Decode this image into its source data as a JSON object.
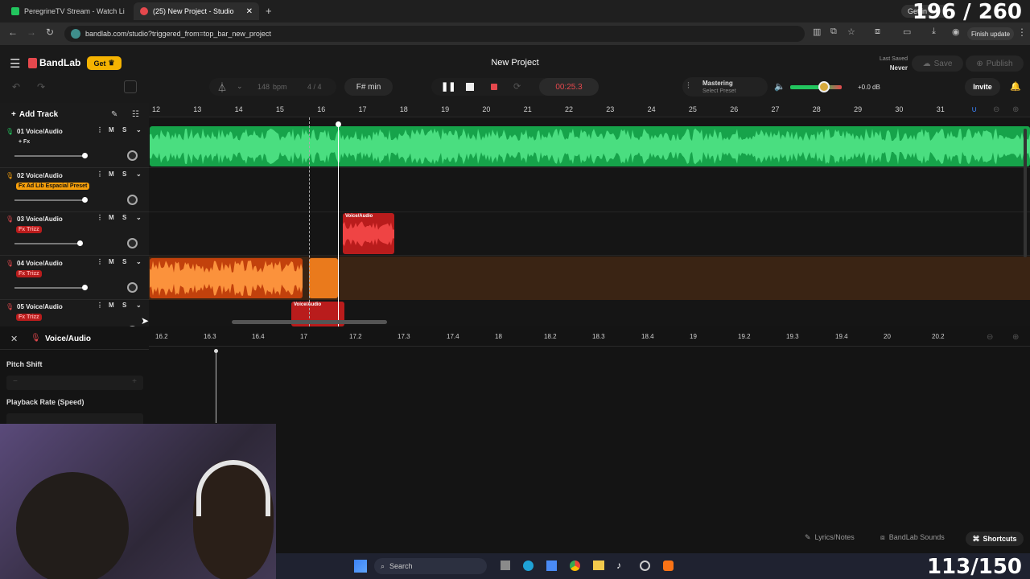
{
  "counters": {
    "top": "196 / 260",
    "bottom": "113/150"
  },
  "browser": {
    "tabs": [
      {
        "label": "PeregrineTV Stream - Watch Li",
        "fav_color": "#22c55e",
        "active": false
      },
      {
        "label": "(25) New Project - Studio",
        "fav_color": "#e5484d",
        "active": true
      }
    ],
    "new_tab": "+",
    "url": "bandlab.com/studio?triggered_from=top_bar_new_project",
    "get_label": "Get in",
    "finish_update": "Finish update"
  },
  "app": {
    "logo": "BandLab",
    "get_button": "Get",
    "project_title": "New Project",
    "last_saved_label": "Last Saved",
    "last_saved_value": "Never",
    "save": "Save",
    "publish": "Publish",
    "bpm_value": "148",
    "bpm_unit": "bpm",
    "time_sig": "4 / 4",
    "key": "F# min",
    "time": "00:25.3",
    "mastering": "Mastering",
    "select_preset": "Select Preset",
    "volume_db": "+0.0 dB",
    "invite": "Invite",
    "add_track": "Add Track"
  },
  "ruler": [
    "12",
    "13",
    "14",
    "15",
    "16",
    "17",
    "18",
    "19",
    "20",
    "21",
    "22",
    "23",
    "24",
    "25",
    "26",
    "27",
    "28",
    "29",
    "30",
    "31"
  ],
  "tracks": [
    {
      "name": "01  Voice/Audio",
      "fx": "+ Fx",
      "fx_style": "plain",
      "color": "#22c55e",
      "volume": 0.7
    },
    {
      "name": "02  Voice/Audio",
      "fx": "Fx Ad Lib Espacial Preset",
      "fx_style": "orange",
      "color": "#f59e0b",
      "volume": 0.7
    },
    {
      "name": "03  Voice/Audio",
      "fx": "Fx Trizz",
      "fx_style": "red",
      "color": "#e5484d",
      "volume": 0.65
    },
    {
      "name": "04  Voice/Audio",
      "fx": "Fx Trizz",
      "fx_style": "red",
      "color": "#e5484d",
      "volume": 0.7
    },
    {
      "name": "05  Voice/Audio",
      "fx": "Fx Trizz",
      "fx_style": "red",
      "color": "#e5484d",
      "volume": 0.7
    }
  ],
  "ms": {
    "m": "M",
    "s": "S"
  },
  "clips": {
    "label": "Voice/Audio"
  },
  "editor": {
    "title": "Voice/Audio",
    "ruler": [
      "16.2",
      "16.3",
      "16.4",
      "17",
      "17.2",
      "17.3",
      "17.4",
      "18",
      "18.2",
      "18.3",
      "18.4",
      "19",
      "19.2",
      "19.3",
      "19.4",
      "20",
      "20.2"
    ],
    "pitch_shift": "Pitch Shift",
    "playback_rate": "Playback Rate (Speed)"
  },
  "bottom": {
    "lyrics": "Lyrics/Notes",
    "sounds": "BandLab Sounds",
    "shortcuts": "Shortcuts"
  },
  "taskbar": {
    "search": "Search"
  }
}
